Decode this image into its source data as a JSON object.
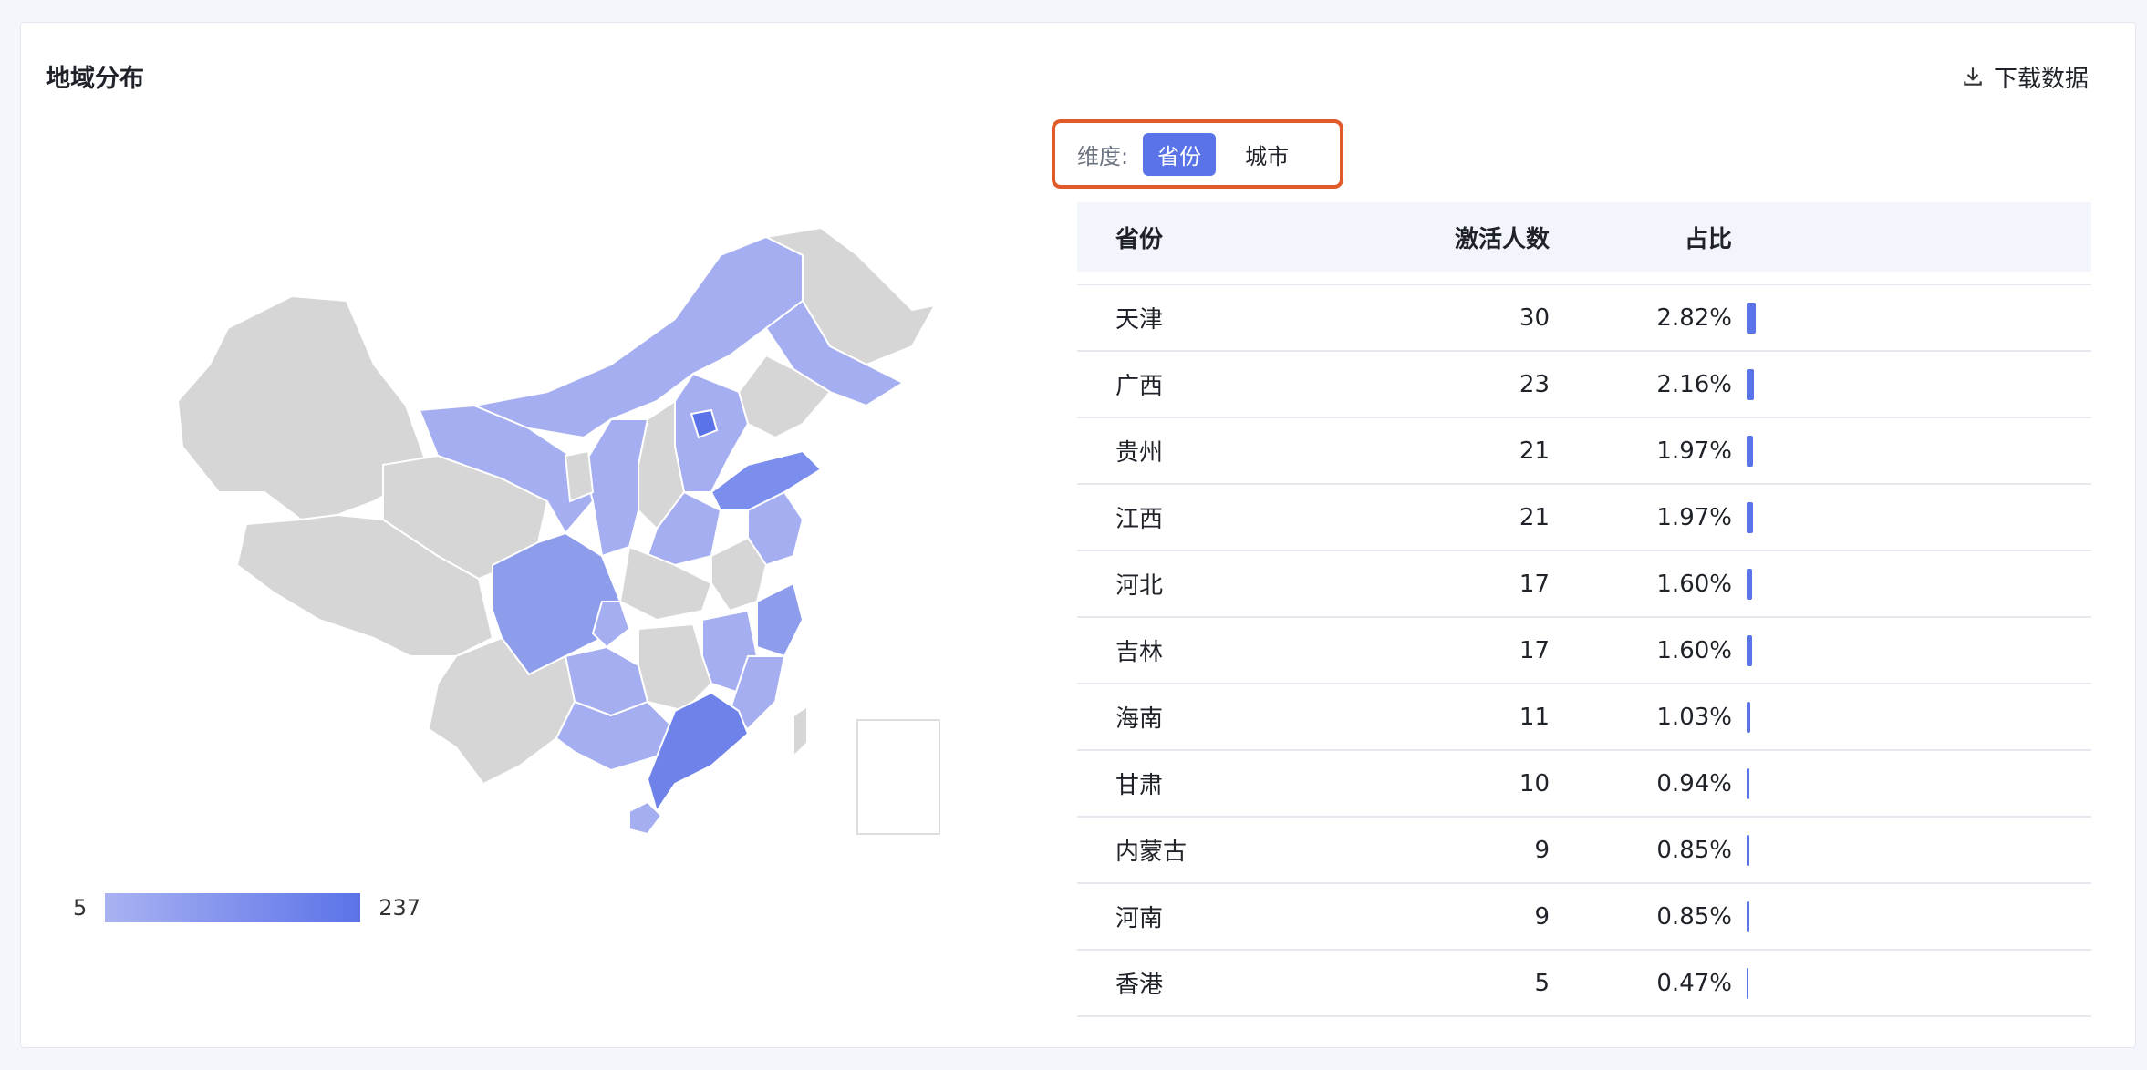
{
  "panel": {
    "title": "地域分布",
    "download_label": "下载数据"
  },
  "dimension": {
    "label": "维度:",
    "options": [
      "省份",
      "城市"
    ],
    "selected": "省份"
  },
  "legend": {
    "min": "5",
    "max": "237",
    "color_low": "#a9b2f2",
    "color_high": "#5b73e8"
  },
  "table": {
    "headers": [
      "省份",
      "激活人数",
      "占比"
    ],
    "rows": [
      {
        "name": "天津",
        "count": "30",
        "pct": "2.82%",
        "share": 2.82
      },
      {
        "name": "广西",
        "count": "23",
        "pct": "2.16%",
        "share": 2.16
      },
      {
        "name": "贵州",
        "count": "21",
        "pct": "1.97%",
        "share": 1.97
      },
      {
        "name": "江西",
        "count": "21",
        "pct": "1.97%",
        "share": 1.97
      },
      {
        "name": "河北",
        "count": "17",
        "pct": "1.60%",
        "share": 1.6
      },
      {
        "name": "吉林",
        "count": "17",
        "pct": "1.60%",
        "share": 1.6
      },
      {
        "name": "海南",
        "count": "11",
        "pct": "1.03%",
        "share": 1.03
      },
      {
        "name": "甘肃",
        "count": "10",
        "pct": "0.94%",
        "share": 0.94
      },
      {
        "name": "内蒙古",
        "count": "9",
        "pct": "0.85%",
        "share": 0.85
      },
      {
        "name": "河南",
        "count": "9",
        "pct": "0.85%",
        "share": 0.85
      },
      {
        "name": "香港",
        "count": "5",
        "pct": "0.47%",
        "share": 0.47
      }
    ]
  },
  "colors": {
    "accent": "#5b73e8",
    "highlight_border": "#e05a2a",
    "no_data": "#d6d6d6"
  }
}
